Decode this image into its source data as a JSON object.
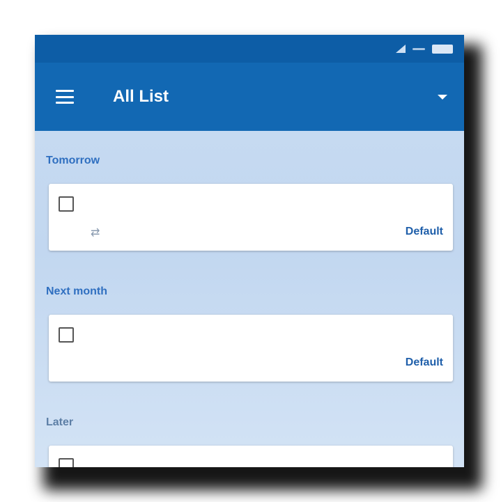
{
  "status_bar": {
    "left_text": ""
  },
  "app_bar": {
    "title": "All List",
    "menu_icon": "hamburger-icon",
    "dropdown_icon": "dropdown-icon"
  },
  "colors": {
    "app_bar": "#1268b3",
    "status_bar": "#0d5da6",
    "accent": "#2e70c4"
  },
  "sections": [
    {
      "header": "Tomorrow",
      "task": {
        "title": "",
        "date": "",
        "list": "Default",
        "repeat_icon": "repeat-icon"
      }
    },
    {
      "header": "Next month",
      "task": {
        "title": "",
        "date": "",
        "list": "Default"
      }
    },
    {
      "header": "Later",
      "task": {
        "title": ""
      }
    }
  ]
}
